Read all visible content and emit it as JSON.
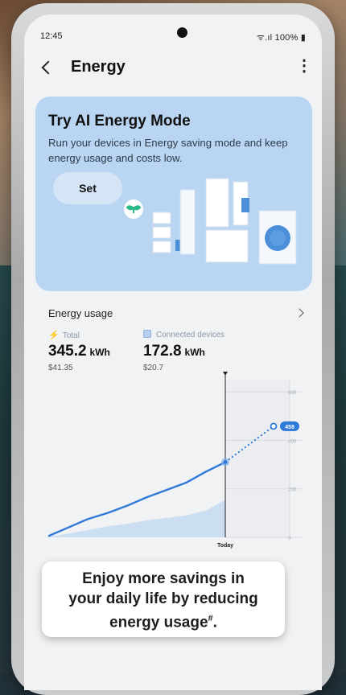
{
  "status_bar": {
    "time": "12:45",
    "signal_battery": "100%"
  },
  "header": {
    "title": "Energy"
  },
  "ai_card": {
    "title": "Try AI Energy Mode",
    "description": "Run your devices in Energy saving mode and keep energy usage and costs low.",
    "set_label": "Set"
  },
  "usage": {
    "title": "Energy usage",
    "total_label": "Total",
    "connected_label": "Connected devices",
    "total_value": "345.2",
    "connected_value": "172.8",
    "unit": "kWh",
    "total_cost": "$41.35",
    "connected_cost": "$20.7"
  },
  "chart_data": {
    "type": "line",
    "today_label": "Today",
    "y_ticks": [
      0,
      200,
      400,
      600
    ],
    "ylim": [
      0,
      650
    ],
    "forecast_label": "458",
    "series": [
      {
        "values": [
          5,
          40,
          75,
          100,
          130,
          165,
          195,
          225,
          270,
          310
        ]
      },
      {
        "values": [
          2,
          15,
          30,
          45,
          55,
          70,
          80,
          90,
          110,
          155
        ]
      }
    ],
    "forecast": {
      "from": 310,
      "to": 458
    }
  },
  "caption": {
    "line1": "Enjoy more savings in",
    "line2": "your daily life by reducing",
    "line3": "energy usage",
    "mark": "#"
  },
  "colors": {
    "accent": "#2f7ad8",
    "card": "#b9d5f2"
  }
}
